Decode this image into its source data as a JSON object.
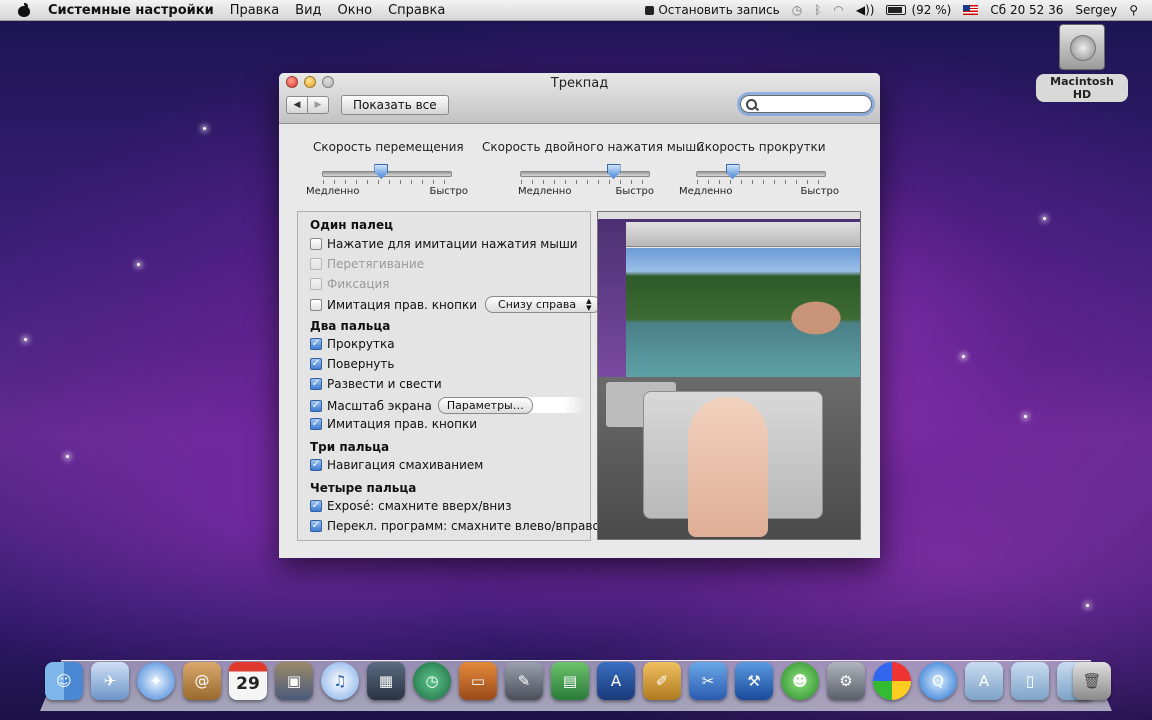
{
  "menubar": {
    "app_name": "Системные настройки",
    "items": [
      "Правка",
      "Вид",
      "Окно",
      "Справка"
    ],
    "record_label": "Остановить запись",
    "battery": "(92 %)",
    "clock": "Сб 20 52 36",
    "user": "Sergey"
  },
  "desktop": {
    "hd_label": "Macintosh HD"
  },
  "window": {
    "title": "Трекпад",
    "show_all": "Показать все",
    "search_value": ""
  },
  "sliders": {
    "tracking": {
      "title": "Скорость перемещения",
      "min_label": "Медленно",
      "max_label": "Быстро",
      "level": 0.45
    },
    "double_click": {
      "title": "Скорость двойного нажатия мыши",
      "min_label": "Медленно",
      "max_label": "Быстро",
      "level": 0.75
    },
    "scrolling": {
      "title": "Скорость прокрутки",
      "min_label": "Медленно",
      "max_label": "Быстро",
      "level": 0.25
    }
  },
  "one_finger": {
    "title": "Один палец",
    "tap_to_click": {
      "label": "Нажатие для имитации нажатия мыши",
      "checked": false
    },
    "dragging": {
      "label": "Перетягивание",
      "checked": false,
      "disabled": true
    },
    "drag_lock": {
      "label": "Фиксация",
      "checked": false,
      "disabled": true
    },
    "secondary_click": {
      "label": "Имитация прав. кнопки",
      "checked": false,
      "popup_value": "Снизу справа"
    }
  },
  "two_fingers": {
    "title": "Два пальца",
    "scroll": {
      "label": "Прокрутка",
      "checked": true
    },
    "rotate": {
      "label": "Повернуть",
      "checked": true
    },
    "pinch": {
      "label": "Развести и свести",
      "checked": true
    },
    "zoom": {
      "label": "Масштаб экрана",
      "checked": true,
      "button": "Параметры…"
    },
    "secondary_click": {
      "label": "Имитация прав. кнопки",
      "checked": true
    }
  },
  "three_fingers": {
    "title": "Три пальца",
    "swipe_nav": {
      "label": "Навигация смахиванием",
      "checked": true
    }
  },
  "four_fingers": {
    "title": "Четыре пальца",
    "expose": {
      "label": "Exposé: смахните вверх/вниз",
      "checked": true
    },
    "app_switch": {
      "label": "Перекл. программ: смахните влево/вправо",
      "checked": true
    }
  },
  "dock": {
    "items": [
      "finder",
      "mail",
      "safari",
      "address-book",
      "ical",
      "iphoto",
      "itunes",
      "spaces",
      "time-machine",
      "keynote",
      "system-tool",
      "numbers",
      "xcode",
      "instruments",
      "pages",
      "developer",
      "adium",
      "system-preferences",
      "color-picker",
      "quicktime",
      "applications-stack",
      "documents-stack",
      "downloads-stack",
      "trash"
    ],
    "ical_day": "29"
  }
}
